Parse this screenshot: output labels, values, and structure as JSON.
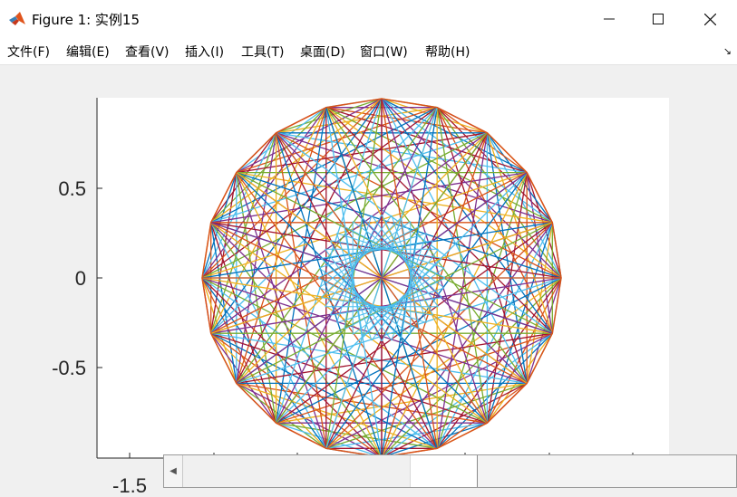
{
  "window": {
    "title": "Figure 1: 实例15",
    "icon": "matlab-logo-icon",
    "controls": [
      "minimize-icon",
      "maximize-icon",
      "close-icon"
    ]
  },
  "menu": {
    "items": [
      "文件(F)",
      "编辑(E)",
      "查看(V)",
      "插入(I)",
      "工具(T)",
      "桌面(D)",
      "窗口(W)",
      "帮助(H)"
    ],
    "dock_icon": "dock-arrow-icon"
  },
  "chart_data": {
    "type": "line",
    "description_of_marks": "multicolored string-art polygon chords on circle",
    "xlim": [
      -1.5,
      1.5
    ],
    "ylim": [
      -1,
      1
    ],
    "yticks": [
      0.5,
      0,
      -0.5
    ],
    "ytick_labels": [
      "0.5",
      "0",
      "-0.5"
    ],
    "xtick_labels": [
      "-1.5"
    ],
    "grid": false,
    "colors": [
      "#0072bd",
      "#d95319",
      "#edb120",
      "#7e2f8e",
      "#77ac30",
      "#4dbeee",
      "#a2142f"
    ]
  },
  "scrollbar": {
    "left_arrow_icon": "scroll-left-arrow-icon"
  }
}
